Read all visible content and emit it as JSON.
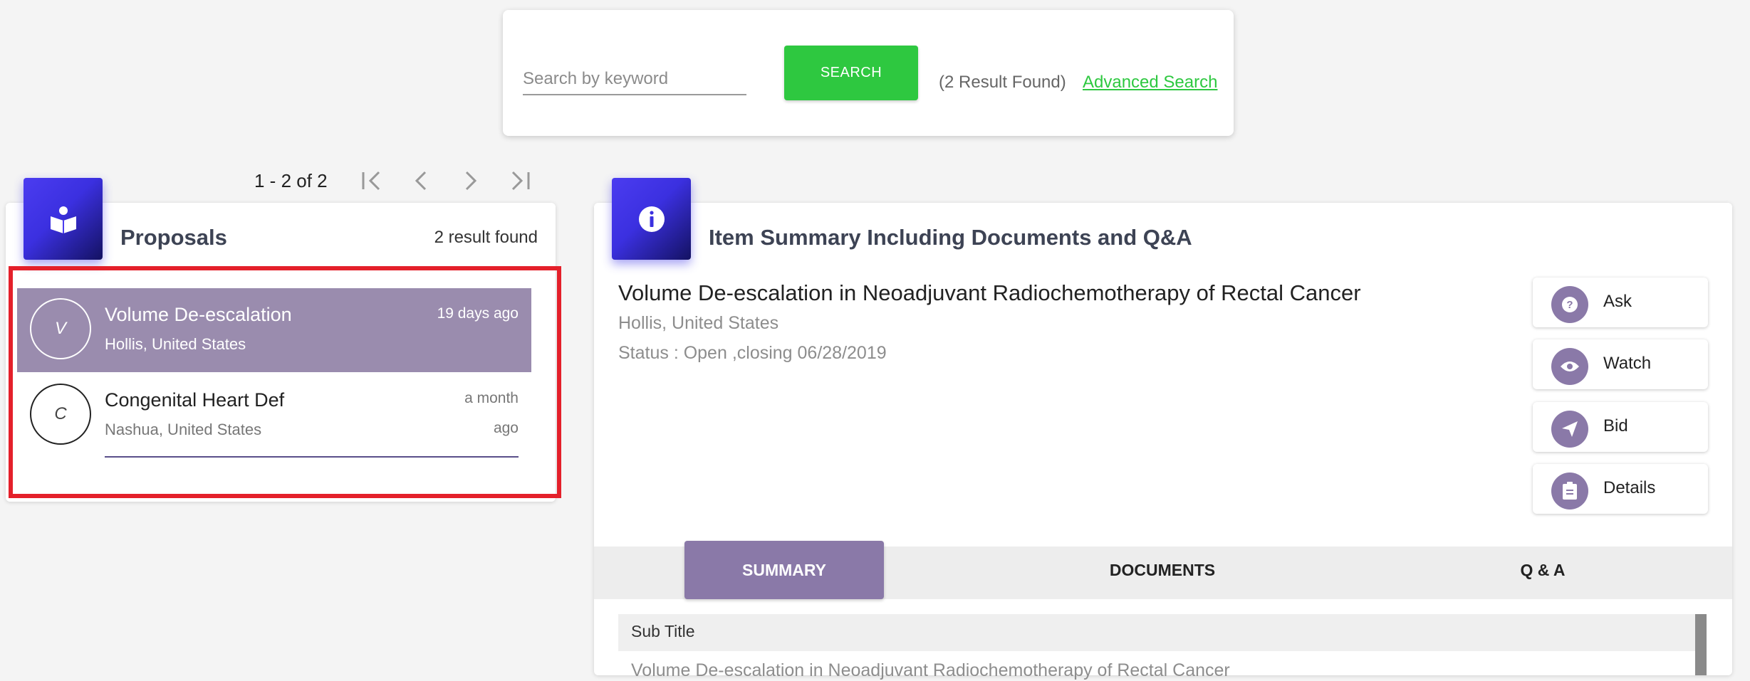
{
  "search": {
    "placeholder": "Search by keyword",
    "button_label": "SEARCH",
    "result_text": "(2 Result Found)",
    "advanced_link": "Advanced Search"
  },
  "pagination": {
    "range": "1 - 2 of 2"
  },
  "proposals": {
    "title": "Proposals",
    "count_text": "2 result found",
    "items": [
      {
        "initial": "V",
        "title": "Volume De-escalation",
        "location": "Hollis, United States",
        "time": "19 days ago",
        "selected": true
      },
      {
        "initial": "C",
        "title": "Congenital Heart Def",
        "location": "Nashua, United States",
        "time": "a month ago",
        "selected": false
      }
    ]
  },
  "summary": {
    "header": "Item Summary Including Documents and Q&A",
    "title": "Volume De-escalation in Neoadjuvant Radiochemotherapy of Rectal Cancer",
    "location": "Hollis, United States",
    "status": "Status : Open ,closing 06/28/2019",
    "actions": [
      {
        "label": "Ask",
        "icon": "question-icon"
      },
      {
        "label": "Watch",
        "icon": "eye-icon"
      },
      {
        "label": "Bid",
        "icon": "send-icon"
      },
      {
        "label": "Details",
        "icon": "clipboard-icon"
      }
    ],
    "tabs": [
      "SUMMARY",
      "DOCUMENTS",
      "Q & A"
    ],
    "active_tab": "SUMMARY",
    "subtitle_label": "Sub Title",
    "subtitle_value": "Volume De-escalation in Neoadjuvant Radiochemotherapy of Rectal Cancer"
  },
  "colors": {
    "accent_green": "#2ec840",
    "accent_purple": "#8a79a8",
    "icon_blue": "#3b30e0",
    "highlight_red": "#e4202a"
  }
}
